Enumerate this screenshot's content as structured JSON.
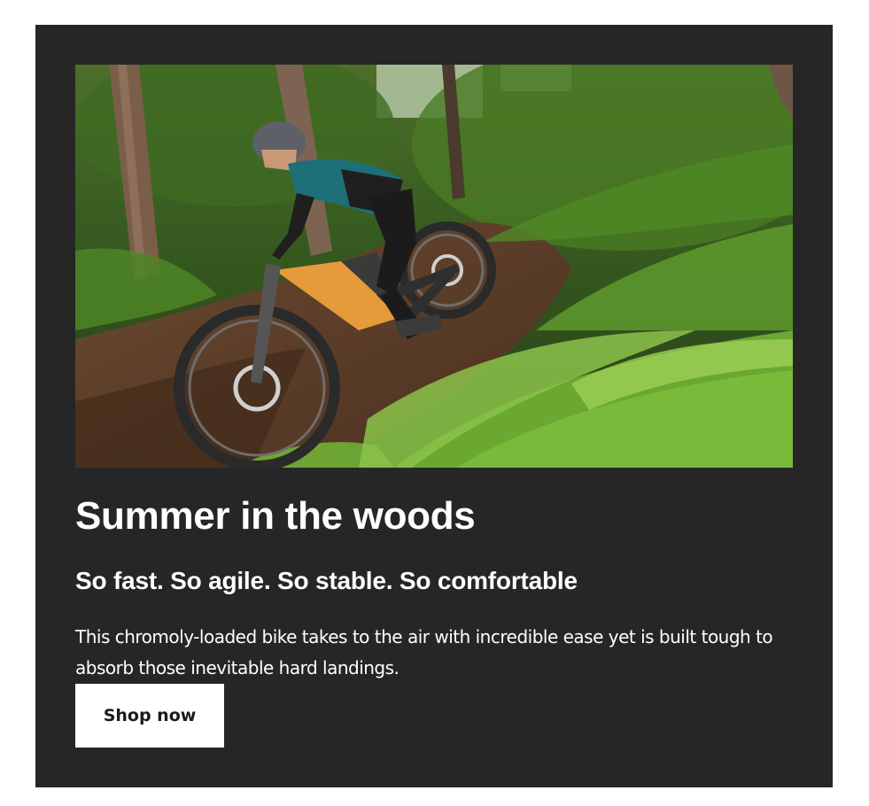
{
  "promo": {
    "image_alt": "Mountain biker riding an orange e-bike down a forest trail among ferns",
    "title": "Summer in the woods",
    "subtitle": "So fast. So agile. So stable. So comfortable",
    "body": "This chromoly-loaded bike takes to the air with incredible ease yet is built tough to absorb those inevitable hard landings.",
    "cta_label": "Shop now"
  },
  "colors": {
    "card_background": "#262626",
    "page_background": "#ffffff",
    "text": "#ffffff",
    "button_background": "#ffffff",
    "button_text": "#1a1a1a"
  }
}
